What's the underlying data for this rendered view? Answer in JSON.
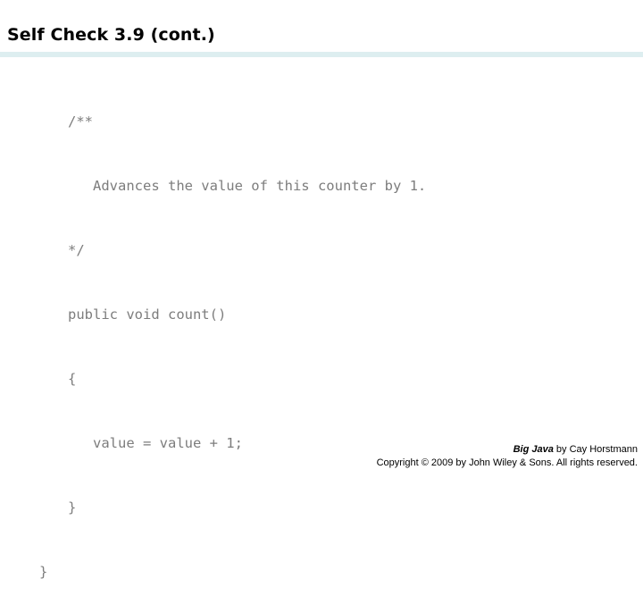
{
  "slide": {
    "title": "Self Check 3.9 (cont.)",
    "divider_color": "#ddeef0",
    "background_color": "#ffffff"
  },
  "code": {
    "text_color": "#7d7d7d",
    "lines": [
      {
        "text": "/**",
        "indent": 1
      },
      {
        "text": "   Advances the value of this counter by 1.",
        "indent": 1
      },
      {
        "text": "*/",
        "indent": 1
      },
      {
        "text": "public void count()",
        "indent": 1
      },
      {
        "text": "{",
        "indent": 1
      },
      {
        "text": "   value = value + 1;",
        "indent": 1
      },
      {
        "text": "}",
        "indent": 1
      },
      {
        "text": "}",
        "indent": 0
      }
    ]
  },
  "footer": {
    "book_title": "Big Java",
    "byline": " by  Cay Horstmann",
    "copyright": "Copyright © 2009 by John Wiley & Sons.  All rights reserved."
  }
}
